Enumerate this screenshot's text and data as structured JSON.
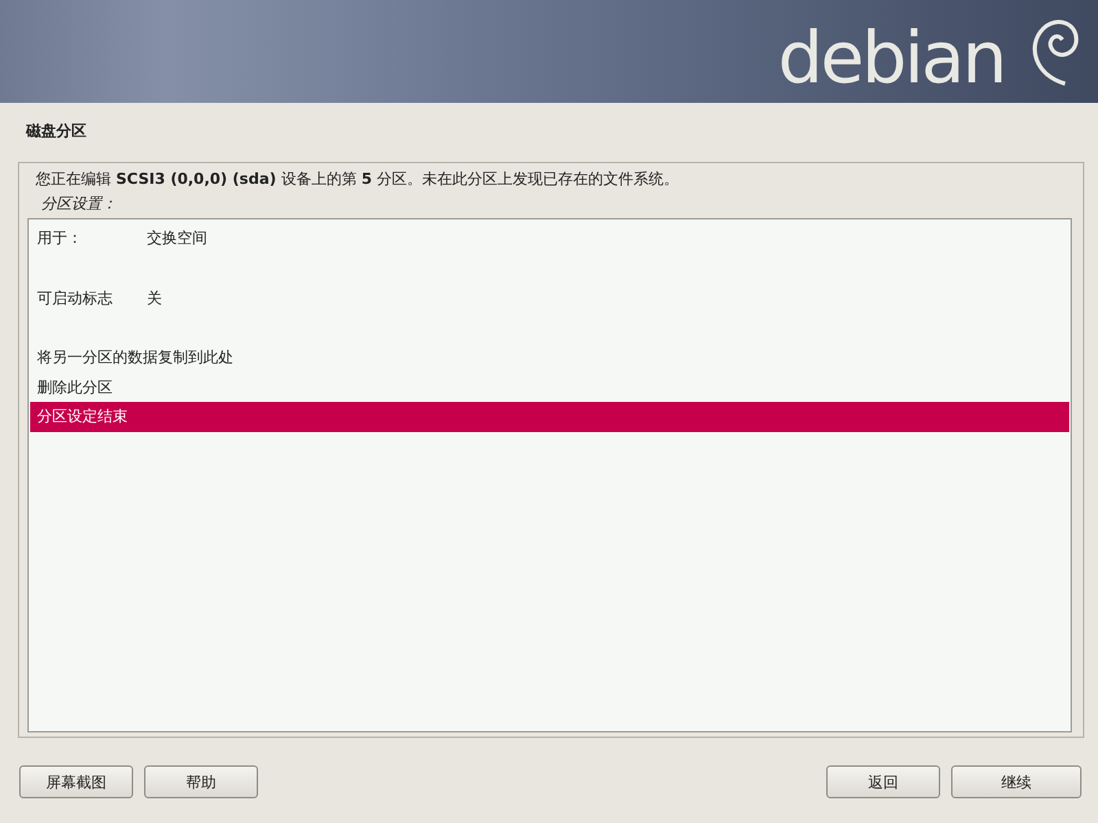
{
  "banner": {
    "logo_text": "debian"
  },
  "title": "磁盘分区",
  "description": "您正在编辑 **SCSI3 (0,0,0) (sda)** 设备上的第 **5** 分区。未在此分区上发现已存在的文件系统。",
  "list_heading": "分区设置：",
  "items": [
    {
      "kind": "setting",
      "label": "用于：",
      "value": "交换空间",
      "selected": false
    },
    {
      "kind": "blank",
      "selected": false
    },
    {
      "kind": "setting",
      "label": "可启动标志",
      "value": "关",
      "selected": false
    },
    {
      "kind": "blank",
      "selected": false
    },
    {
      "kind": "action",
      "label": "将另一分区的数据复制到此处",
      "selected": false
    },
    {
      "kind": "action",
      "label": "删除此分区",
      "selected": false
    },
    {
      "kind": "action",
      "label": "分区设定结束",
      "selected": true
    }
  ],
  "buttons_left": [
    "屏幕截图",
    "帮助"
  ],
  "buttons_right": [
    "返回",
    "继续"
  ]
}
